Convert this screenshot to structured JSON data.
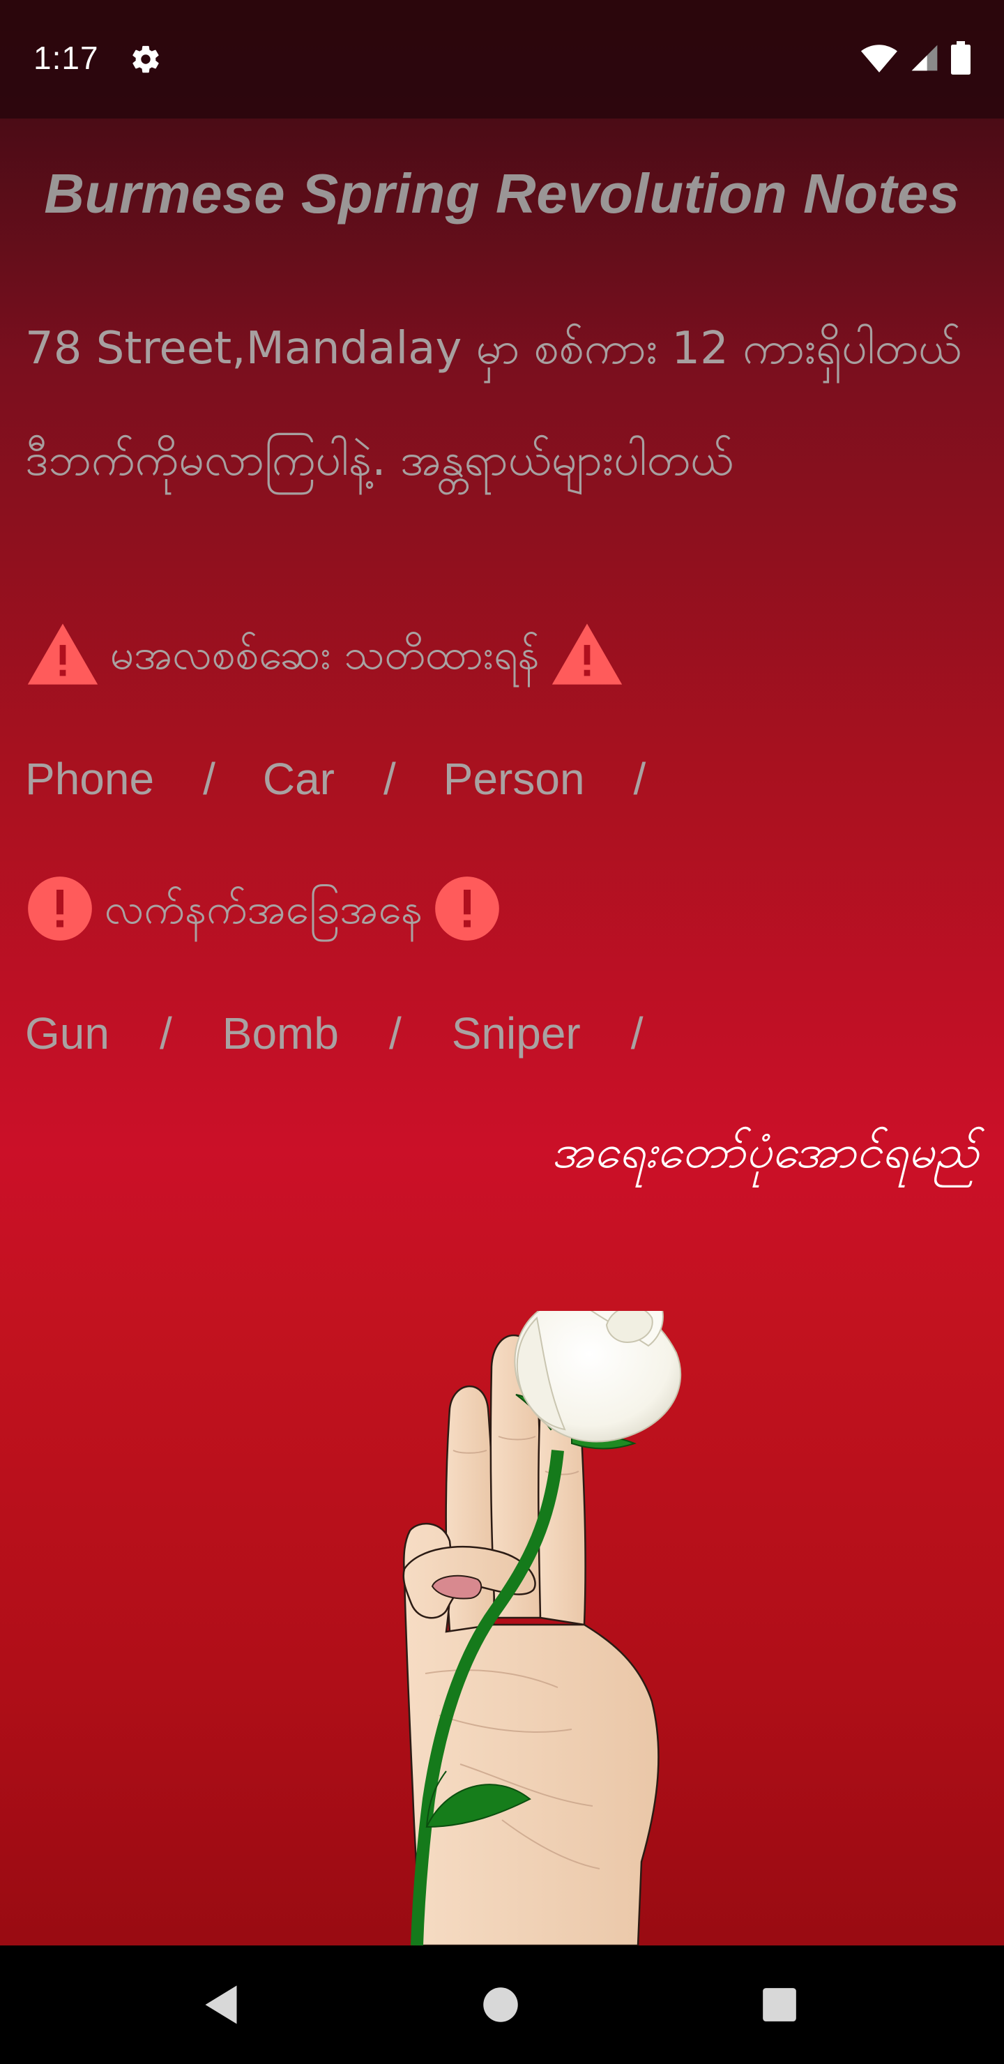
{
  "status_bar": {
    "time": "1:17",
    "settings_icon": "gear-icon",
    "wifi_icon": "wifi-icon",
    "signal_icon": "cell-signal-icon",
    "battery_icon": "battery-icon"
  },
  "app": {
    "title": "Burmese Spring Revolution Notes",
    "location_note": "78 Street,Mandalay  မှာ စစ်ကား 12 ကားရှိပါတယ် ဒီဘက်ကိုမလာကြပါနဲ့. အန္တရာယ်များပါတယ်",
    "warning_heading": "မအလစစ်ဆေး သတိထားရန်",
    "hazard_tags": [
      {
        "label": "Phone",
        "sep": "/"
      },
      {
        "label": "Car",
        "sep": "/"
      },
      {
        "label": "Person",
        "sep": "/"
      }
    ],
    "status_heading": "လက်နက်အခြေအနေ",
    "weapon_tags": [
      {
        "label": "Gun",
        "sep": "/"
      },
      {
        "label": "Bomb",
        "sep": "/"
      },
      {
        "label": "Sniper",
        "sep": "/"
      }
    ],
    "slogan": "အရေးတော်ပုံအောင်ရမည်",
    "illustration": "three-finger-salute-with-white-rose"
  },
  "nav_bar": {
    "back_icon": "back-triangle-icon",
    "home_icon": "home-circle-icon",
    "recents_icon": "recents-square-icon"
  },
  "colors": {
    "background_top": "#3e0a12",
    "background_mid": "#cb1028",
    "background_bottom": "#8c0a0f",
    "title_text": "#9a9696",
    "body_text": "#a7a0a0",
    "warning_icon": "#ff5b5b",
    "slogan_text": "#ffffff",
    "nav_bar": "#000000"
  }
}
